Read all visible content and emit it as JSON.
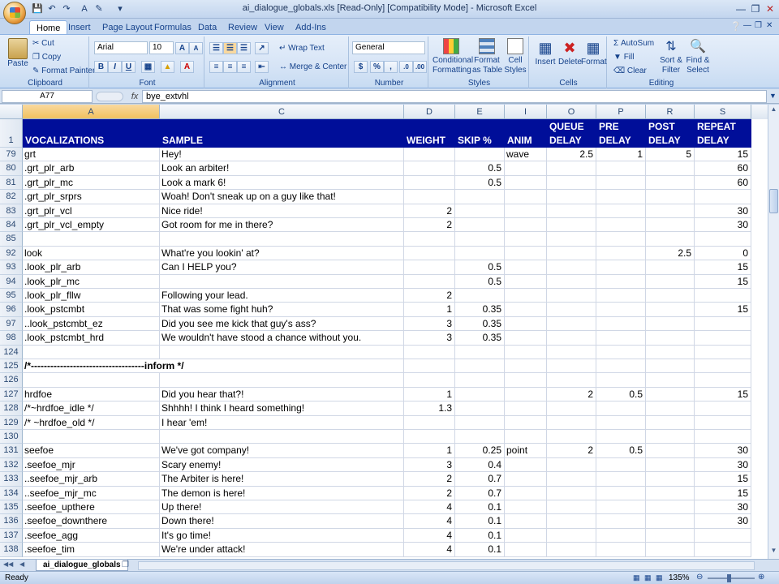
{
  "window": {
    "title": "ai_dialogue_globals.xls  [Read-Only]  [Compatibility Mode] - Microsoft Excel"
  },
  "tabs": [
    "Home",
    "Insert",
    "Page Layout",
    "Formulas",
    "Data",
    "Review",
    "View",
    "Add-Ins"
  ],
  "ribbon": {
    "clipboard": {
      "paste": "Paste",
      "cut": "Cut",
      "copy": "Copy",
      "format_painter": "Format Painter",
      "label": "Clipboard"
    },
    "font": {
      "name": "Arial",
      "size": "10",
      "label": "Font",
      "bold": "B",
      "italic": "I",
      "underline": "U"
    },
    "alignment": {
      "wrap": "Wrap Text",
      "merge": "Merge & Center",
      "label": "Alignment"
    },
    "number": {
      "format": "General",
      "label": "Number",
      "currency": "$",
      "percent": "%",
      "comma": ","
    },
    "styles": {
      "cond1": "Conditional",
      "cond2": "Formatting",
      "fmt1": "Format",
      "fmt2": "as Table",
      "cell1": "Cell",
      "cell2": "Styles",
      "label": "Styles"
    },
    "cells": {
      "insert": "Insert",
      "delete": "Delete",
      "format": "Format",
      "label": "Cells"
    },
    "editing": {
      "autosum": "AutoSum",
      "fill": "Fill",
      "clear": "Clear",
      "sort1": "Sort &",
      "sort2": "Filter",
      "find1": "Find &",
      "find2": "Select",
      "label": "Editing"
    }
  },
  "formula_bar": {
    "name_box": "A77",
    "fx": "fx",
    "content": "bye_extvhl"
  },
  "columns": [
    "A",
    "C",
    "D",
    "E",
    "I",
    "O",
    "P",
    "R",
    "S"
  ],
  "header_row": {
    "num": "1",
    "cols": [
      [
        "",
        "VOCALIZATIONS"
      ],
      [
        "",
        "SAMPLE"
      ],
      [
        "",
        "WEIGHT"
      ],
      [
        "",
        "SKIP %"
      ],
      [
        "",
        "ANIM"
      ],
      [
        "QUEUE",
        "DELAY"
      ],
      [
        "PRE",
        "DELAY"
      ],
      [
        "POST",
        "DELAY"
      ],
      [
        "REPEAT",
        "DELAY"
      ]
    ]
  },
  "rows": [
    {
      "n": "79",
      "c": [
        "grt",
        "Hey!",
        "",
        "",
        "wave",
        "2.5",
        "1",
        "5",
        "15"
      ]
    },
    {
      "n": "80",
      "c": [
        ".grt_plr_arb",
        "Look an arbiter!",
        "",
        "0.5",
        "",
        "",
        "",
        "",
        "60"
      ]
    },
    {
      "n": "81",
      "c": [
        ".grt_plr_mc",
        "Look a mark 6!",
        "",
        "0.5",
        "",
        "",
        "",
        "",
        "60"
      ]
    },
    {
      "n": "82",
      "c": [
        ".grt_plr_srprs",
        "Woah! Don't sneak up on a guy like that!",
        "",
        "",
        "",
        "",
        "",
        "",
        ""
      ]
    },
    {
      "n": "83",
      "c": [
        ".grt_plr_vcl",
        "Nice ride!",
        "2",
        "",
        "",
        "",
        "",
        "",
        "30"
      ]
    },
    {
      "n": "84",
      "c": [
        ".grt_plr_vcl_empty",
        "Got room for me in there?",
        "2",
        "",
        "",
        "",
        "",
        "",
        "30"
      ]
    },
    {
      "n": "85",
      "c": [
        "",
        "",
        "",
        "",
        "",
        "",
        "",
        "",
        ""
      ]
    },
    {
      "n": "92",
      "c": [
        "look",
        "What're you lookin' at?",
        "",
        "",
        "",
        "",
        "",
        "2.5",
        "0"
      ]
    },
    {
      "n": "93",
      "c": [
        ".look_plr_arb",
        "Can I HELP you?",
        "",
        "0.5",
        "",
        "",
        "",
        "",
        "15"
      ]
    },
    {
      "n": "94",
      "c": [
        ".look_plr_mc",
        "",
        "",
        "0.5",
        "",
        "",
        "",
        "",
        "15"
      ]
    },
    {
      "n": "95",
      "c": [
        ".look_plr_fllw",
        "Following your lead.",
        "2",
        "",
        "",
        "",
        "",
        "",
        ""
      ]
    },
    {
      "n": "96",
      "c": [
        ".look_pstcmbt",
        "That was some fight huh?",
        "1",
        "0.35",
        "",
        "",
        "",
        "",
        "15"
      ]
    },
    {
      "n": "97",
      "c": [
        "..look_pstcmbt_ez",
        "Did you see me kick that guy's ass?",
        "3",
        "0.35",
        "",
        "",
        "",
        "",
        ""
      ]
    },
    {
      "n": "98",
      "c": [
        ".look_pstcmbt_hrd",
        "We wouldn't have stood a chance without you.",
        "3",
        "0.35",
        "",
        "",
        "",
        "",
        ""
      ]
    },
    {
      "n": "124",
      "c": [
        "",
        "",
        "",
        "",
        "",
        "",
        "",
        "",
        ""
      ]
    },
    {
      "n": "125",
      "c": [
        "/*-----------------------------------inform */",
        "",
        "",
        "",
        "",
        "",
        "",
        "",
        ""
      ],
      "bold": true
    },
    {
      "n": "126",
      "c": [
        "",
        "",
        "",
        "",
        "",
        "",
        "",
        "",
        ""
      ]
    },
    {
      "n": "127",
      "c": [
        "hrdfoe",
        "Did you hear that?!",
        "1",
        "",
        "",
        "2",
        "0.5",
        "",
        "15"
      ]
    },
    {
      "n": "128",
      "c": [
        "/*~hrdfoe_idle */",
        "Shhhh! I think I heard something!",
        "1.3",
        "",
        "",
        "",
        "",
        "",
        ""
      ]
    },
    {
      "n": "129",
      "c": [
        "/* ~hrdfoe_old */",
        "I hear 'em!",
        "",
        "",
        "",
        "",
        "",
        "",
        ""
      ]
    },
    {
      "n": "130",
      "c": [
        "",
        "",
        "",
        "",
        "",
        "",
        "",
        "",
        ""
      ]
    },
    {
      "n": "131",
      "c": [
        "seefoe",
        "We've got company!",
        "1",
        "0.25",
        "point",
        "2",
        "0.5",
        "",
        "30"
      ]
    },
    {
      "n": "132",
      "c": [
        ".seefoe_mjr",
        "Scary enemy!",
        "3",
        "0.4",
        "",
        "",
        "",
        "",
        "30"
      ]
    },
    {
      "n": "133",
      "c": [
        "..seefoe_mjr_arb",
        "The Arbiter is here!",
        "2",
        "0.7",
        "",
        "",
        "",
        "",
        "15"
      ]
    },
    {
      "n": "134",
      "c": [
        "..seefoe_mjr_mc",
        "The demon is here!",
        "2",
        "0.7",
        "",
        "",
        "",
        "",
        "15"
      ]
    },
    {
      "n": "135",
      "c": [
        ".seefoe_upthere",
        "Up there!",
        "4",
        "0.1",
        "",
        "",
        "",
        "",
        "30"
      ]
    },
    {
      "n": "136",
      "c": [
        ".seefoe_downthere",
        "Down there!",
        "4",
        "0.1",
        "",
        "",
        "",
        "",
        "30"
      ]
    },
    {
      "n": "137",
      "c": [
        ".seefoe_agg",
        "It's go time!",
        "4",
        "0.1",
        "",
        "",
        "",
        "",
        ""
      ]
    },
    {
      "n": "138",
      "c": [
        ".seefoe_tim",
        "We're under attack!",
        "4",
        "0.1",
        "",
        "",
        "",
        "",
        ""
      ]
    }
  ],
  "sheet_tab": "ai_dialogue_globals",
  "status": {
    "ready": "Ready",
    "zoom": "135%"
  },
  "colors": {
    "header_bg": "#000e99",
    "header_text": "#ffffff",
    "accent": "#15428b"
  }
}
